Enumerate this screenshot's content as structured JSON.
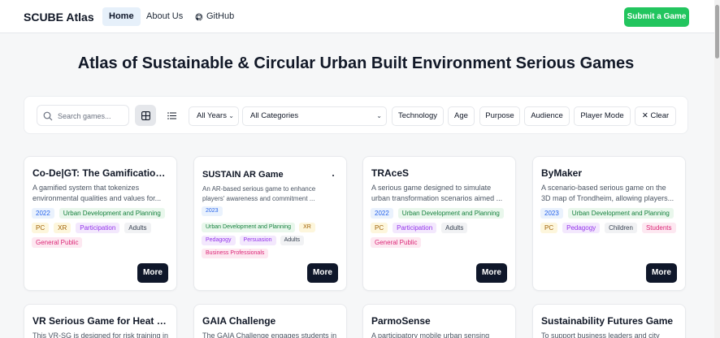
{
  "header": {
    "brand": "SCUBE Atlas",
    "nav": [
      {
        "label": "Home"
      },
      {
        "label": "About Us"
      },
      {
        "label": "GitHub"
      }
    ],
    "submit_label": "Submit a Game"
  },
  "page_title": "Atlas of Sustainable & Circular Urban Built Environment Serious Games",
  "filters": {
    "search_placeholder": "Search games...",
    "years_value": "All Years",
    "categories_value": "All Categories",
    "buttons": [
      "Technology",
      "Age",
      "Purpose",
      "Audience",
      "Player Mode"
    ],
    "clear_label": "Clear"
  },
  "cards": [
    {
      "title": "Co-De|GT: The Gamification ...",
      "desc": [
        "A gamified system that tokenizes",
        "environmental qualities and values for..."
      ],
      "tags": [
        {
          "text": "2022",
          "color": "blue"
        },
        {
          "text": "Urban Development and Planning",
          "color": "green"
        },
        {
          "text": "PC",
          "color": "yellow"
        },
        {
          "text": "XR",
          "color": "yellow"
        },
        {
          "text": "Participation",
          "color": "purple"
        },
        {
          "text": "Adults",
          "color": "gray"
        },
        {
          "text": "General Public",
          "color": "pink"
        }
      ],
      "more_label": "More"
    },
    {
      "title": "SUSTAIN AR Game",
      "desc": [
        "An AR-based serious game to enhance",
        "players' awareness and commitment ..."
      ],
      "tags": [
        {
          "text": "2023",
          "color": "blue"
        },
        {
          "text": "Urban Development and Planning",
          "color": "green"
        },
        {
          "text": "XR",
          "color": "yellow"
        },
        {
          "text": "Pedagogy",
          "color": "purple"
        },
        {
          "text": "Persuasion",
          "color": "purple"
        },
        {
          "text": "Adults",
          "color": "gray"
        },
        {
          "text": "Business Professionals",
          "color": "pink"
        }
      ],
      "more_label": "More"
    },
    {
      "title": "TRAceS",
      "desc": [
        "A serious game designed to simulate",
        "urban transformation scenarios aimed ..."
      ],
      "tags": [
        {
          "text": "2022",
          "color": "blue"
        },
        {
          "text": "Urban Development and Planning",
          "color": "green"
        },
        {
          "text": "PC",
          "color": "yellow"
        },
        {
          "text": "Participation",
          "color": "purple"
        },
        {
          "text": "Adults",
          "color": "gray"
        },
        {
          "text": "General Public",
          "color": "pink"
        }
      ],
      "more_label": "More"
    },
    {
      "title": "ByMaker",
      "desc": [
        "A scenario-based serious game on the",
        "3D map of Trondheim, allowing players..."
      ],
      "tags": [
        {
          "text": "2023",
          "color": "blue"
        },
        {
          "text": "Urban Development and Planning",
          "color": "green"
        },
        {
          "text": "PC",
          "color": "yellow"
        },
        {
          "text": "Pedagogy",
          "color": "purple"
        },
        {
          "text": "Children",
          "color": "gray"
        },
        {
          "text": "Students",
          "color": "pink"
        }
      ],
      "more_label": "More"
    },
    {
      "title": "VR Serious Game for Heat W...",
      "desc": [
        "This VR-SG is designed for risk training in"
      ]
    },
    {
      "title": "GAIA Challenge",
      "desc": [
        "The GAIA Challenge engages students in"
      ]
    },
    {
      "title": "ParmoSense",
      "desc": [
        "A participatory mobile urban sensing"
      ]
    },
    {
      "title": "Sustainability Futures Game",
      "desc": [
        "To support business leaders and city"
      ]
    }
  ],
  "colors": {
    "accent_green": "#22c55e",
    "more_button": "#0f172a",
    "nav_active_bg": "#e6f0fa"
  },
  "icons": [
    "github-icon",
    "search-icon",
    "grid-view-icon",
    "list-view-icon",
    "chevron-down-icon",
    "close-icon"
  ]
}
